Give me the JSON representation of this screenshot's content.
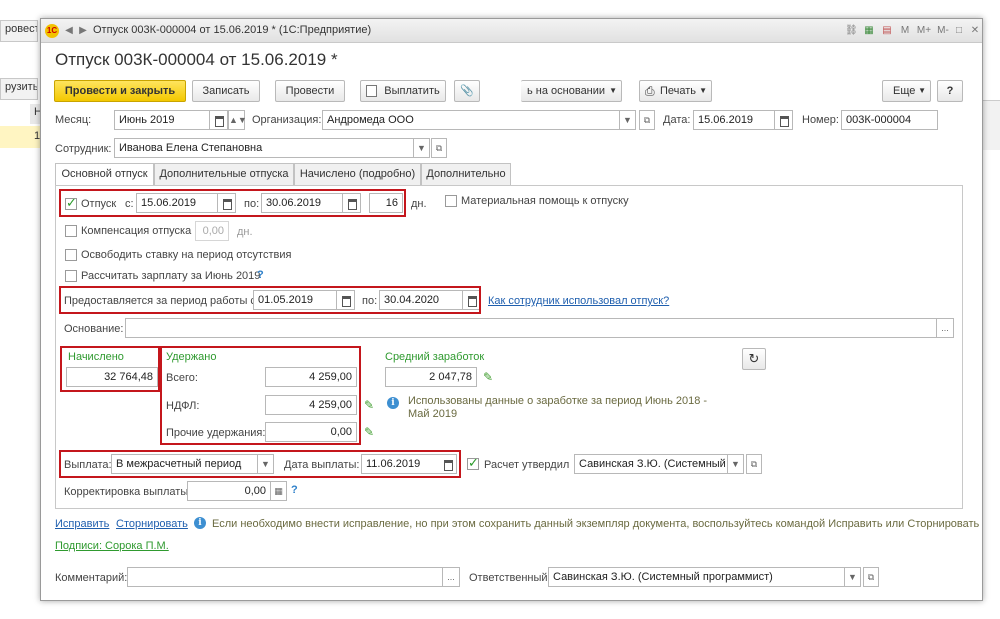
{
  "background_app": {
    "btn1": "ровести",
    "btn2": "рузить и",
    "col_header": "Н",
    "row_cell": "1:"
  },
  "window": {
    "title": "Отпуск 003К-000004 от 15.06.2019 * (1С:Предприятие)",
    "logo_text": "1С",
    "title_icons": [
      "M",
      "M+",
      "M-"
    ]
  },
  "document": {
    "title": "Отпуск 003К-000004 от 15.06.2019 *"
  },
  "toolbar": {
    "post_close": "Провести и закрыть",
    "save": "Записать",
    "post": "Провести",
    "pay": "Выплатить",
    "based_on": "ь на основании",
    "print": "Печать",
    "more": "Еще",
    "help": "?"
  },
  "header_fields": {
    "month_label": "Месяц:",
    "month_value": "Июнь 2019",
    "org_label": "Организация:",
    "org_value": "Андромеда ООО",
    "date_label": "Дата:",
    "date_value": "15.06.2019",
    "number_label": "Номер:",
    "number_value": "003К-000004",
    "employee_label": "Сотрудник:",
    "employee_value": "Иванова Елена Степановна"
  },
  "tabs": [
    {
      "label": "Основной отпуск",
      "active": true
    },
    {
      "label": "Дополнительные отпуска",
      "active": false
    },
    {
      "label": "Начислено (подробно)",
      "active": false
    },
    {
      "label": "Дополнительно",
      "active": false
    }
  ],
  "vacation": {
    "checkbox_label": "Отпуск",
    "from_label": "с:",
    "from_value": "15.06.2019",
    "to_label": "по:",
    "to_value": "30.06.2019",
    "days_value": "16",
    "days_unit": "дн.",
    "material_help_label": "Материальная помощь к отпуску",
    "compensation_label": "Компенсация отпуска",
    "compensation_value": "0,00",
    "compensation_unit": "дн.",
    "free_rate_label": "Освободить ставку на период отсутствия",
    "calc_salary_label": "Рассчитать зарплату за Июнь 2019",
    "calc_salary_help": "?"
  },
  "period": {
    "label": "Предоставляется за период работы с:",
    "from_value": "01.05.2019",
    "to_label": "по:",
    "to_value": "30.04.2020",
    "usage_link": "Как сотрудник использовал отпуск?"
  },
  "basis": {
    "label": "Основание:",
    "value": "",
    "btn": "..."
  },
  "accrued": {
    "title": "Начислено",
    "value": "32 764,48"
  },
  "withheld": {
    "title": "Удержано",
    "total_label": "Всего:",
    "total_value": "4 259,00",
    "ndfl_label": "НДФЛ:",
    "ndfl_value": "4 259,00",
    "other_label": "Прочие удержания:",
    "other_value": "0,00"
  },
  "average": {
    "title": "Средний заработок",
    "value": "2 047,78",
    "info_text": "Использованы данные о заработке за период Июнь 2018 - Май 2019"
  },
  "payment": {
    "label": "Выплата:",
    "value": "В межрасчетный период",
    "date_label": "Дата выплаты:",
    "date_value": "11.06.2019",
    "approved_label": "Расчет утвердил",
    "approved_value": "Савинская З.Ю. (Системный п",
    "adjust_label": "Корректировка выплаты:",
    "adjust_value": "0,00",
    "adjust_help": "?"
  },
  "footer": {
    "fix_link": "Исправить",
    "reverse_link": "Сторнировать",
    "info_text": "Если необходимо внести исправление, но при этом сохранить данный экземпляр документа, воспользуйтесь командой Исправить или Сторнировать",
    "signatures_link": "Подписи: Сорока П.М.",
    "comment_label": "Комментарий:",
    "comment_value": "",
    "comment_btn": "...",
    "responsible_label": "Ответственный:",
    "responsible_value": "Савинская З.Ю. (Системный программист)"
  },
  "colors": {
    "primary_button": "#f3c800",
    "highlight_box": "#c4161c",
    "green_text": "#2f9a2f",
    "link": "#1f5fae",
    "info_icon": "#3d8fd1"
  }
}
